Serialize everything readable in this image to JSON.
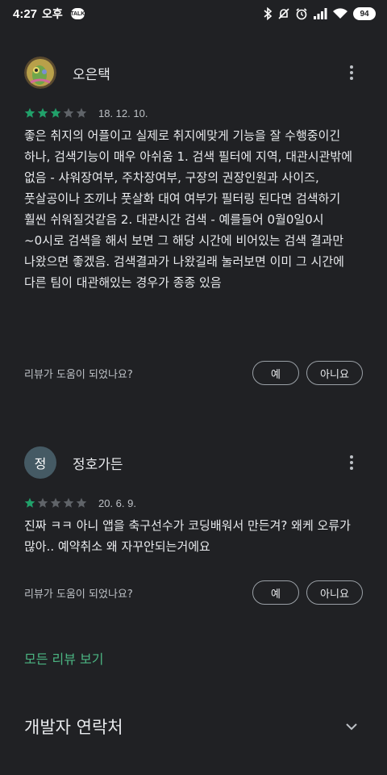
{
  "status_bar": {
    "time": "4:27",
    "period": "오후",
    "msg_badge": "TALK",
    "battery": "94",
    "icons": [
      "bluetooth-icon",
      "mute-icon",
      "alarm-icon",
      "signal-icon",
      "wifi-icon",
      "battery-icon"
    ]
  },
  "reviews": [
    {
      "name": "오은택",
      "rating": 3,
      "max_rating": 5,
      "date": "18. 12. 10.",
      "text": "좋은 취지의 어플이고 실제로 취지에맞게 기능을 잘 수행중이긴 하나, 검색기능이 매우 아쉬움 1. 검색 필터에 지역, 대관시관밖에 없음 - 샤워장여부, 주차장여부, 구장의 권장인원과 사이즈, 풋살공이나 조끼나 풋살화 대여 여부가 필터링 된다면 검색하기 훨씬 쉬워질것같음 2. 대관시간 검색 - 예를들어 0월0일0시~0시로 검색을 해서 보면 그 해당 시간에 비어있는 검색 결과만 나왔으면 좋겠음. 검색결과가 나왔길래 눌러보면 이미 그 시간에 다른 팀이 대관해있는 경우가 종종 있음",
      "helpful_q": "리뷰가 도움이 되었나요?",
      "yes": "예",
      "no": "아니요"
    },
    {
      "name": "정호가든",
      "avatar_letter": "정",
      "rating": 1,
      "max_rating": 5,
      "date": "20. 6. 9.",
      "text": "진짜 ㅋㅋ 아니 앱을 축구선수가 코딩배워서 만든겨? 왜케 오류가 많아.. 예약취소 왜 자꾸안되는거에요",
      "helpful_q": "리뷰가 도움이 되었나요?",
      "yes": "예",
      "no": "아니요"
    }
  ],
  "all_reviews_label": "모든 리뷰 보기",
  "developer_contact": "개발자 연락처",
  "colors": {
    "background": "#202124",
    "accent": "#4bb582",
    "star_filled": "#21a06a",
    "star_empty": "#5f6368"
  }
}
